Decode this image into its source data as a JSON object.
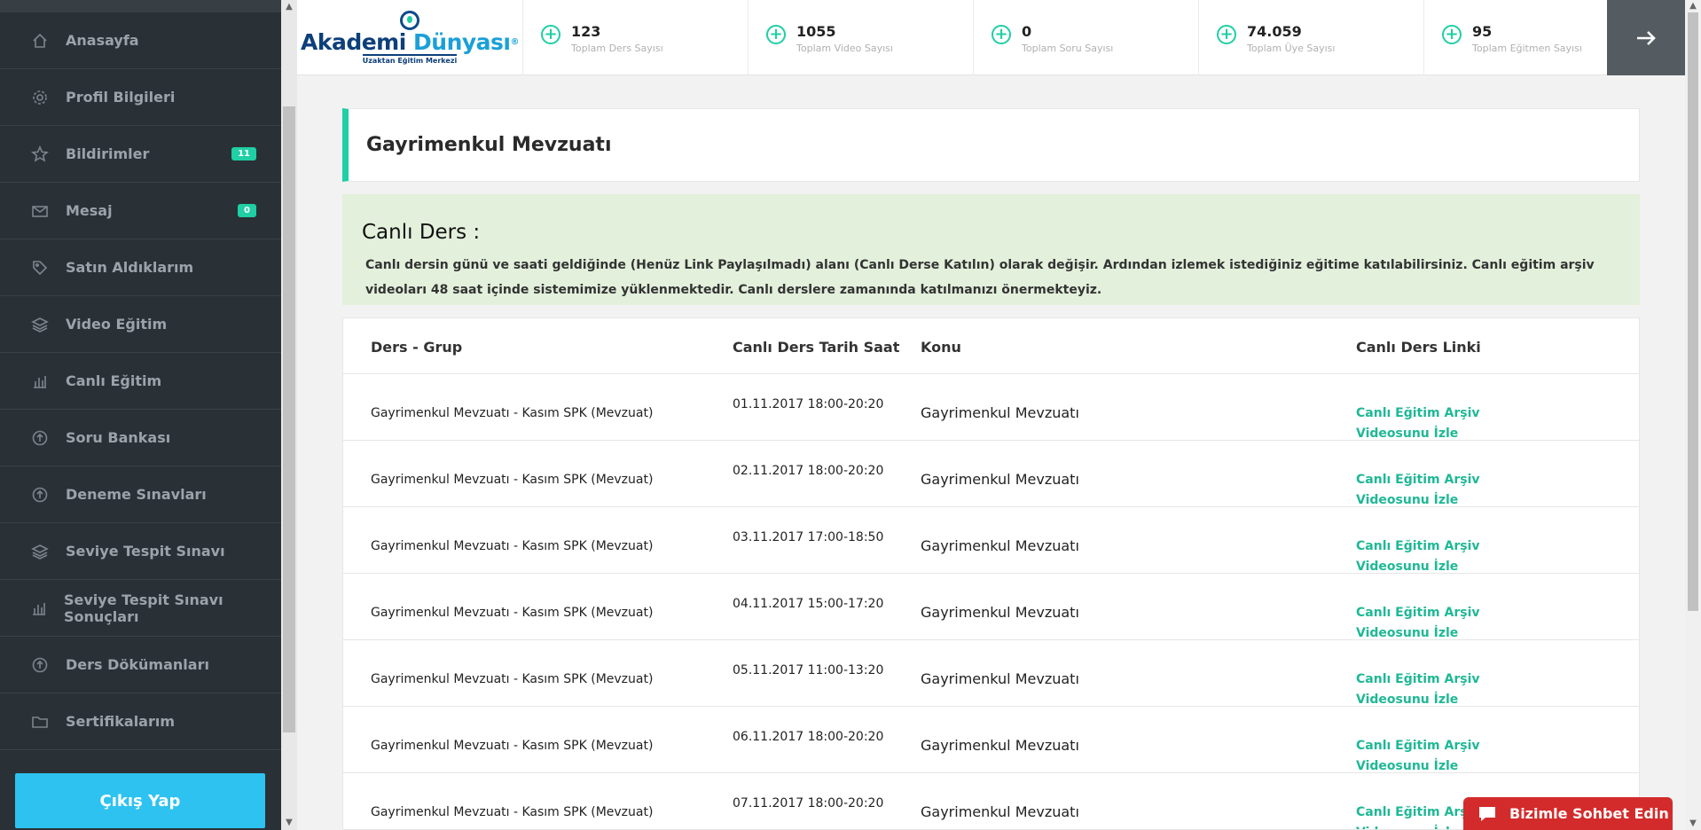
{
  "sidebar": {
    "items": [
      {
        "label": "Anasayfa",
        "icon": "home-icon"
      },
      {
        "label": "Profil Bilgileri",
        "icon": "gear-icon"
      },
      {
        "label": "Bildirimler",
        "icon": "star-icon",
        "badge": "11"
      },
      {
        "label": "Mesaj",
        "icon": "envelope-icon",
        "badge": "0"
      },
      {
        "label": "Satın Aldıklarım",
        "icon": "tag-icon"
      },
      {
        "label": "Video Eğitim",
        "icon": "layers-icon"
      },
      {
        "label": "Canlı Eğitim",
        "icon": "bar-chart-icon"
      },
      {
        "label": "Soru Bankası",
        "icon": "arrow-up-circle-icon"
      },
      {
        "label": "Deneme Sınavları",
        "icon": "arrow-up-circle-icon"
      },
      {
        "label": "Seviye Tespit Sınavı",
        "icon": "layers-icon"
      },
      {
        "label": "Seviye Tespit Sınavı Sonuçları",
        "icon": "bar-chart-icon"
      },
      {
        "label": "Ders Dökümanları",
        "icon": "arrow-up-circle-icon"
      },
      {
        "label": "Sertifikalarım",
        "icon": "folder-icon"
      }
    ],
    "logout_label": "Çıkış Yap"
  },
  "header": {
    "logo": {
      "name_part1": "Akademi",
      "name_part2": "Dünyası",
      "registered": "®",
      "tagline": "Uzaktan Eğitim Merkezi"
    },
    "stats": [
      {
        "value": "123",
        "caption": "Toplam Ders Sayısı"
      },
      {
        "value": "1055",
        "caption": "Toplam Video Sayısı"
      },
      {
        "value": "0",
        "caption": "Toplam Soru Sayısı"
      },
      {
        "value": "74.059",
        "caption": "Toplam Üye Sayısı"
      },
      {
        "value": "95",
        "caption": "Toplam Eğitmen Sayısı"
      }
    ],
    "accent": "#1fcfa5"
  },
  "page": {
    "title": "Gayrimenkul Mevzuatı"
  },
  "info": {
    "heading": "Canlı Ders :",
    "text": "Canlı dersin günü ve saati geldiğinde (Henüz Link Paylaşılmadı) alanı (Canlı Derse Katılın) olarak değişir. Ardından izlemek istediğiniz eğitime katılabilirsiniz. Canlı eğitim arşiv videoları 48 saat içinde sistemimize yüklenmektedir. Canlı derslere zamanında katılmanızı önermekteyiz."
  },
  "table": {
    "headers": [
      "Ders - Grup",
      "Canlı Ders Tarih Saat",
      "Konu",
      "Canlı Ders Linki"
    ],
    "rows": [
      {
        "group": "Gayrimenkul Mevzuatı - Kasım SPK (Mevzuat)",
        "datetime": "01.11.2017 18:00-20:20",
        "topic": "Gayrimenkul Mevzuatı",
        "link": "Canlı Eğitim Arşiv Videosunu İzle"
      },
      {
        "group": "Gayrimenkul Mevzuatı - Kasım SPK (Mevzuat)",
        "datetime": "02.11.2017 18:00-20:20",
        "topic": "Gayrimenkul Mevzuatı",
        "link": "Canlı Eğitim Arşiv Videosunu İzle"
      },
      {
        "group": "Gayrimenkul Mevzuatı - Kasım SPK (Mevzuat)",
        "datetime": "03.11.2017 17:00-18:50",
        "topic": "Gayrimenkul Mevzuatı",
        "link": "Canlı Eğitim Arşiv Videosunu İzle"
      },
      {
        "group": "Gayrimenkul Mevzuatı - Kasım SPK (Mevzuat)",
        "datetime": "04.11.2017 15:00-17:20",
        "topic": "Gayrimenkul Mevzuatı",
        "link": "Canlı Eğitim Arşiv Videosunu İzle"
      },
      {
        "group": "Gayrimenkul Mevzuatı - Kasım SPK (Mevzuat)",
        "datetime": "05.11.2017 11:00-13:20",
        "topic": "Gayrimenkul Mevzuatı",
        "link": "Canlı Eğitim Arşiv Videosunu İzle"
      },
      {
        "group": "Gayrimenkul Mevzuatı - Kasım SPK (Mevzuat)",
        "datetime": "06.11.2017 18:00-20:20",
        "topic": "Gayrimenkul Mevzuatı",
        "link": "Canlı Eğitim Arşiv Videosunu İzle"
      },
      {
        "group": "Gayrimenkul Mevzuatı - Kasım SPK (Mevzuat)",
        "datetime": "07.11.2017 18:00-20:20",
        "topic": "Gayrimenkul Mevzuatı",
        "link": "Canlı Eğitim Arşiv Videosunu İzle"
      }
    ]
  },
  "chat": {
    "label": "Bizimle Sohbet Edin",
    "icon": "chat-bubble-icon",
    "color": "#d32b2b"
  }
}
